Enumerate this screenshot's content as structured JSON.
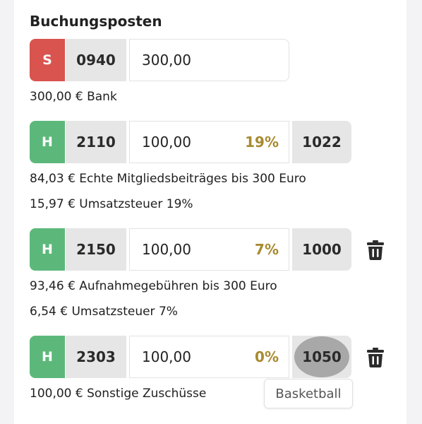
{
  "section_title": "Buchungsposten",
  "rows": [
    {
      "side": "S",
      "account": "0940",
      "amount": "300,00",
      "tax": "",
      "counter": "",
      "lines": [
        "300,00 € Bank"
      ]
    },
    {
      "side": "H",
      "account": "2110",
      "amount": "100,00",
      "tax": "19%",
      "counter": "1022",
      "lines": [
        "84,03 € Echte Mitgliedsbeiträges bis 300 Euro",
        "15,97 € Umsatzsteuer 19%"
      ]
    },
    {
      "side": "H",
      "account": "2150",
      "amount": "100,00",
      "tax": "7%",
      "counter": "1000",
      "lines": [
        "93,46 € Aufnahmegebühren bis 300 Euro",
        "6,54 € Umsatzsteuer 7%"
      ]
    },
    {
      "side": "H",
      "account": "2303",
      "amount": "100,00",
      "tax": "0%",
      "counter": "1050",
      "lines": [
        "100,00 € Sonstige Zuschüsse"
      ]
    }
  ],
  "tooltip": "Basketball",
  "colors": {
    "soll": "#d9534f",
    "haben": "#5cb87a",
    "tax": "#a88a30"
  },
  "icons": {
    "delete": "trash-icon"
  }
}
